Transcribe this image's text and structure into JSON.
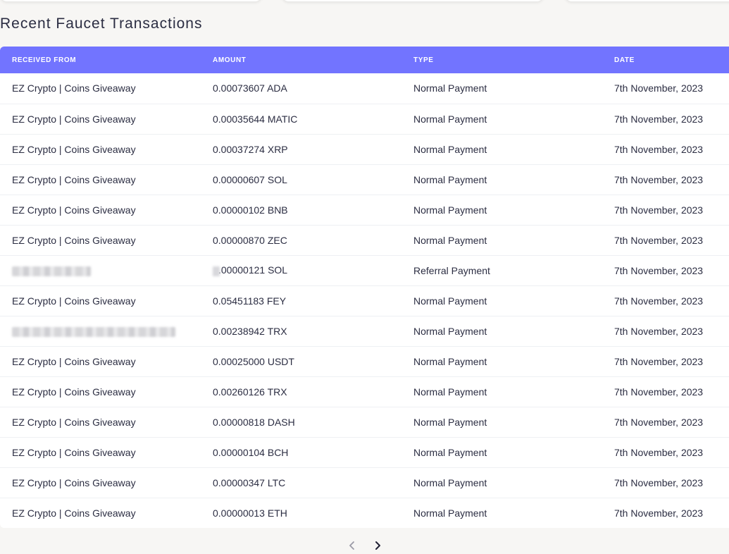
{
  "page": {
    "title": "Recent Faucet Transactions"
  },
  "table": {
    "headers": [
      "RECEIVED FROM",
      "AMOUNT",
      "TYPE",
      "DATE"
    ],
    "rows": [
      {
        "from": "EZ Crypto | Coins Giveaway",
        "amount": "0.00073607 ADA",
        "type": "Normal Payment",
        "date": "7th November, 2023"
      },
      {
        "from": "EZ Crypto | Coins Giveaway",
        "amount": "0.00035644 MATIC",
        "type": "Normal Payment",
        "date": "7th November, 2023"
      },
      {
        "from": "EZ Crypto | Coins Giveaway",
        "amount": "0.00037274 XRP",
        "type": "Normal Payment",
        "date": "7th November, 2023"
      },
      {
        "from": "EZ Crypto | Coins Giveaway",
        "amount": "0.00000607 SOL",
        "type": "Normal Payment",
        "date": "7th November, 2023"
      },
      {
        "from": "EZ Crypto | Coins Giveaway",
        "amount": "0.00000102 BNB",
        "type": "Normal Payment",
        "date": "7th November, 2023"
      },
      {
        "from": "EZ Crypto | Coins Giveaway",
        "amount": "0.00000870 ZEC",
        "type": "Normal Payment",
        "date": "7th November, 2023"
      },
      {
        "from": "",
        "amount": ".00000121 SOL",
        "type": "Referral Payment",
        "date": "7th November, 2023",
        "redacted": true
      },
      {
        "from": "EZ Crypto | Coins Giveaway",
        "amount": "0.05451183 FEY",
        "type": "Normal Payment",
        "date": "7th November, 2023"
      },
      {
        "from": "",
        "amount": "0.00238942 TRX",
        "type": "Normal Payment",
        "date": "7th November, 2023",
        "redacted_long": true
      },
      {
        "from": "EZ Crypto | Coins Giveaway",
        "amount": "0.00025000 USDT",
        "type": "Normal Payment",
        "date": "7th November, 2023"
      },
      {
        "from": "EZ Crypto | Coins Giveaway",
        "amount": "0.00260126 TRX",
        "type": "Normal Payment",
        "date": "7th November, 2023"
      },
      {
        "from": "EZ Crypto | Coins Giveaway",
        "amount": "0.00000818 DASH",
        "type": "Normal Payment",
        "date": "7th November, 2023"
      },
      {
        "from": "EZ Crypto | Coins Giveaway",
        "amount": "0.00000104 BCH",
        "type": "Normal Payment",
        "date": "7th November, 2023"
      },
      {
        "from": "EZ Crypto | Coins Giveaway",
        "amount": "0.00000347 LTC",
        "type": "Normal Payment",
        "date": "7th November, 2023"
      },
      {
        "from": "EZ Crypto | Coins Giveaway",
        "amount": "0.00000013 ETH",
        "type": "Normal Payment",
        "date": "7th November, 2023"
      }
    ]
  },
  "pagination": {
    "prev_icon": "chevron-left-icon",
    "next_icon": "chevron-right-icon"
  },
  "colors": {
    "header_bg": "#7274ff",
    "page_bg": "#f7f6f4",
    "text": "#2b2d42"
  }
}
